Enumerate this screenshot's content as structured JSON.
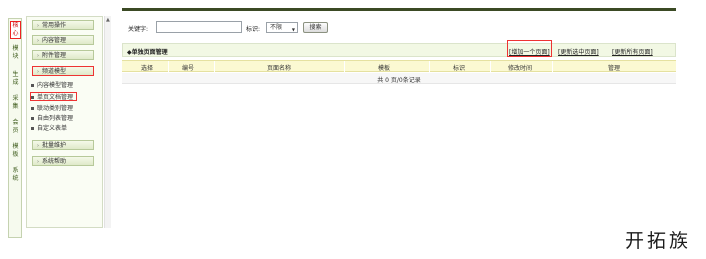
{
  "vertical_tabs": [
    "核心",
    "模块",
    "生成",
    "采集",
    "会员",
    "模板",
    "系统"
  ],
  "sidebar": {
    "menus": [
      {
        "label": "常用操作"
      },
      {
        "label": "内容管理"
      },
      {
        "label": "附件管理"
      },
      {
        "label": "频道模型"
      }
    ],
    "sub_items": [
      "内容模型管理",
      "单页文档管理",
      "联动类别管理",
      "自由列表管理",
      "自定义表单"
    ],
    "menus_after": [
      {
        "label": "批量维护"
      },
      {
        "label": "系统帮助"
      }
    ]
  },
  "search": {
    "keyword_label": "关键字:",
    "keyword_value": "",
    "attr_label": "标识:",
    "attr_selected": "不限",
    "button_label": "搜索"
  },
  "panel": {
    "title": "◆单独页面管理",
    "actions": [
      "[增加一个页面]",
      "[更新选中页面]",
      "[更新所有页面]"
    ]
  },
  "table": {
    "columns": [
      "选择",
      "编号",
      "页面名称",
      "模板",
      "标识",
      "修改时间",
      "管理"
    ],
    "empty_text": "共 0 页/0条记录"
  },
  "watermark": "开拓族",
  "colors": {
    "top_strip": "#3b4a24",
    "table_header_bg": "#fbf9d2",
    "highlight_border": "#e33333"
  }
}
